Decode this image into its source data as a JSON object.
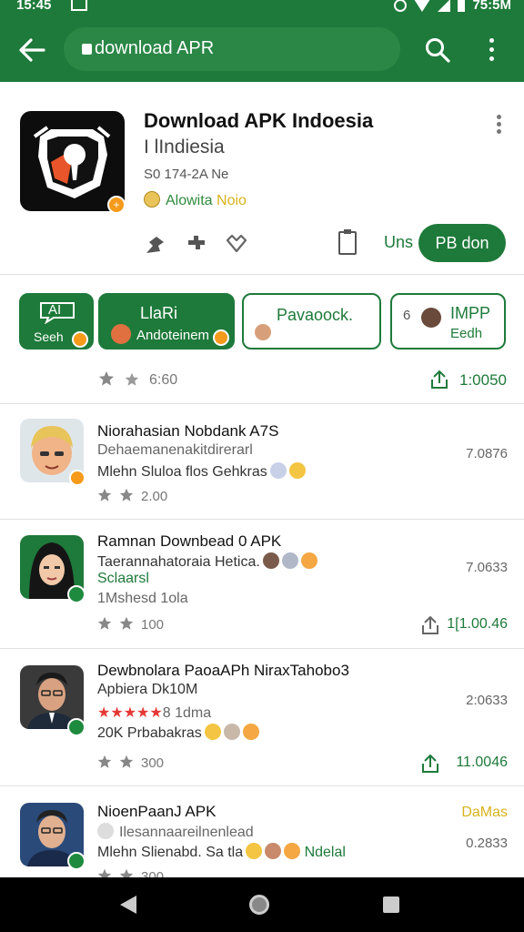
{
  "status_bar": {
    "time": "15:45",
    "right_time": "75:5M"
  },
  "toolbar": {
    "url": "download APR"
  },
  "app": {
    "title": "Download APK Indoesia",
    "subtitle": "I lIndiesia",
    "size": "S0 174-2A Ne",
    "developer_green": "Alowita",
    "developer_yellow": "Noio",
    "uns_label": "Uns",
    "install_label": "PB don"
  },
  "chips": [
    {
      "line1": "AI",
      "line2": "Seeh"
    },
    {
      "line1": "LlaRi",
      "line2": "Andoteinem"
    },
    {
      "line1": "Pavaoock.",
      "line2": ""
    },
    {
      "line1": "IMPP",
      "line2": "Eedh",
      "prefix": "6"
    }
  ],
  "stats": {
    "rating_text": "6:60",
    "downloads": "1:0050"
  },
  "list": [
    {
      "title": "Niorahasian Nobdank A7S",
      "line1": "Dehaemanenakitdirerarl",
      "line2": "Mlehn Sluloa flos Gehkras",
      "rating": "2.00",
      "size": "7.0876",
      "count": ""
    },
    {
      "title": "Ramnan Downbead 0 APK",
      "line1": "Taerannahatoraia Hetica.",
      "line2": "Sclaarsl",
      "line3": "1Mshesd 1ola",
      "rating": "100",
      "size": "7.0633",
      "count": "1[1.00.46"
    },
    {
      "title": "Dewbnolara PaoaAPh NiraxTahobo3",
      "line1": "Apbiera Dk10M",
      "line2": "8 1dma",
      "line3": "20K Prbabakras",
      "rating": "300",
      "size": "2:0633",
      "count": "11.0046"
    },
    {
      "title": "NioenPaanJ APK",
      "line1": "Ilesannaareilnenlead",
      "line2": "Mlehn Slienabd. Sa tla",
      "line2b": "Ndelal",
      "rating": "300",
      "size": "0.2833",
      "badge": "DaMas"
    }
  ]
}
